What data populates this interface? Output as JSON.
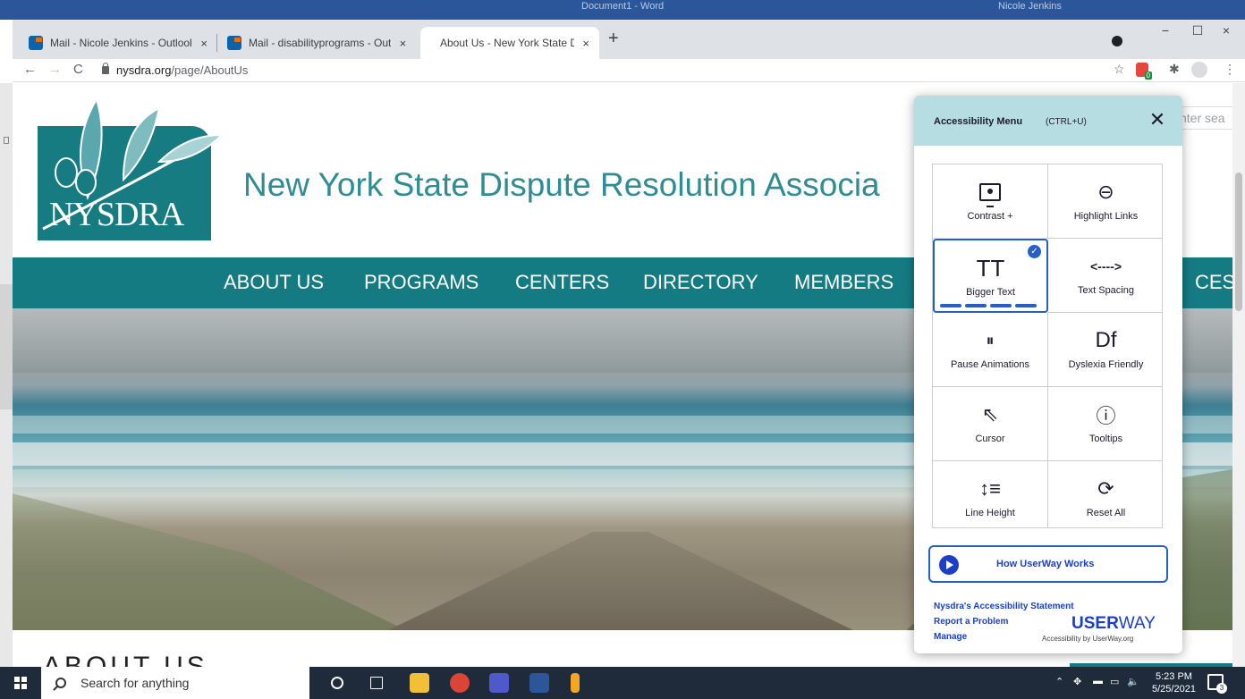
{
  "word": {
    "title": "Document1 - Word",
    "user": "Nicole Jenkins"
  },
  "browser": {
    "tabs": [
      {
        "label": "Mail - Nicole Jenkins - Outlook",
        "close": "×"
      },
      {
        "label": "Mail - disabilityprograms - Outlo",
        "close": "×"
      },
      {
        "label": "About Us - New York State Dispu",
        "close": "×"
      }
    ],
    "new_tab": "+",
    "minimize": "−",
    "maximize": "☐",
    "close": "×",
    "url_host": "nysdra.org",
    "url_path": "/page/AboutUs"
  },
  "site": {
    "logo_text": "NYSDRA",
    "title": "New York State Dispute Resolution Associa",
    "search_placeholder": "nter sea",
    "nav": [
      "ABOUT US",
      "PROGRAMS",
      "CENTERS",
      "DIRECTORY",
      "MEMBERS",
      "CES"
    ],
    "heading_fragment": "ABOUT US"
  },
  "accessibility": {
    "title": "Accessibility Menu",
    "shortcut": "(CTRL+U)",
    "close": "✕",
    "tiles": [
      {
        "label": "Contrast +",
        "icon": "monitor-icon"
      },
      {
        "label": "Highlight Links",
        "icon": "link-icon"
      },
      {
        "label": "Bigger Text",
        "icon": "text-size-icon",
        "selected": true
      },
      {
        "label": "Text Spacing",
        "icon": "text-spacing-icon"
      },
      {
        "label": "Pause Animations",
        "icon": "pause-icon"
      },
      {
        "label": "Dyslexia Friendly",
        "icon": "dyslexia-icon"
      },
      {
        "label": "Cursor",
        "icon": "cursor-icon"
      },
      {
        "label": "Tooltips",
        "icon": "tooltip-icon"
      },
      {
        "label": "Line Height",
        "icon": "line-height-icon"
      },
      {
        "label": "Reset All",
        "icon": "reset-icon"
      }
    ],
    "glyphs": {
      "link": "⊖",
      "bigger_text": "TT",
      "text_spacing": "<---->",
      "pause": "⏸",
      "dyslexia": "Df",
      "cursor": "⇖",
      "tooltip": "ⓘ",
      "line_height": "↕≡",
      "reset": "⟳",
      "check": "✓"
    },
    "how_label": "How UserWay Works",
    "statement_link": "Nysdra's Accessibility Statement",
    "report_link": "Report a Problem",
    "manage_link": "Manage",
    "brand_bold": "USER",
    "brand_light": "WAY",
    "brand_sub": "Accessibility by UserWay.org"
  },
  "taskbar": {
    "search_placeholder": "Search for anything",
    "time": "5:23 PM",
    "date": "5/25/2021"
  },
  "colors": {
    "teal": "#157b82",
    "accent_blue": "#2560c9",
    "panel_header": "#b5dde2"
  }
}
